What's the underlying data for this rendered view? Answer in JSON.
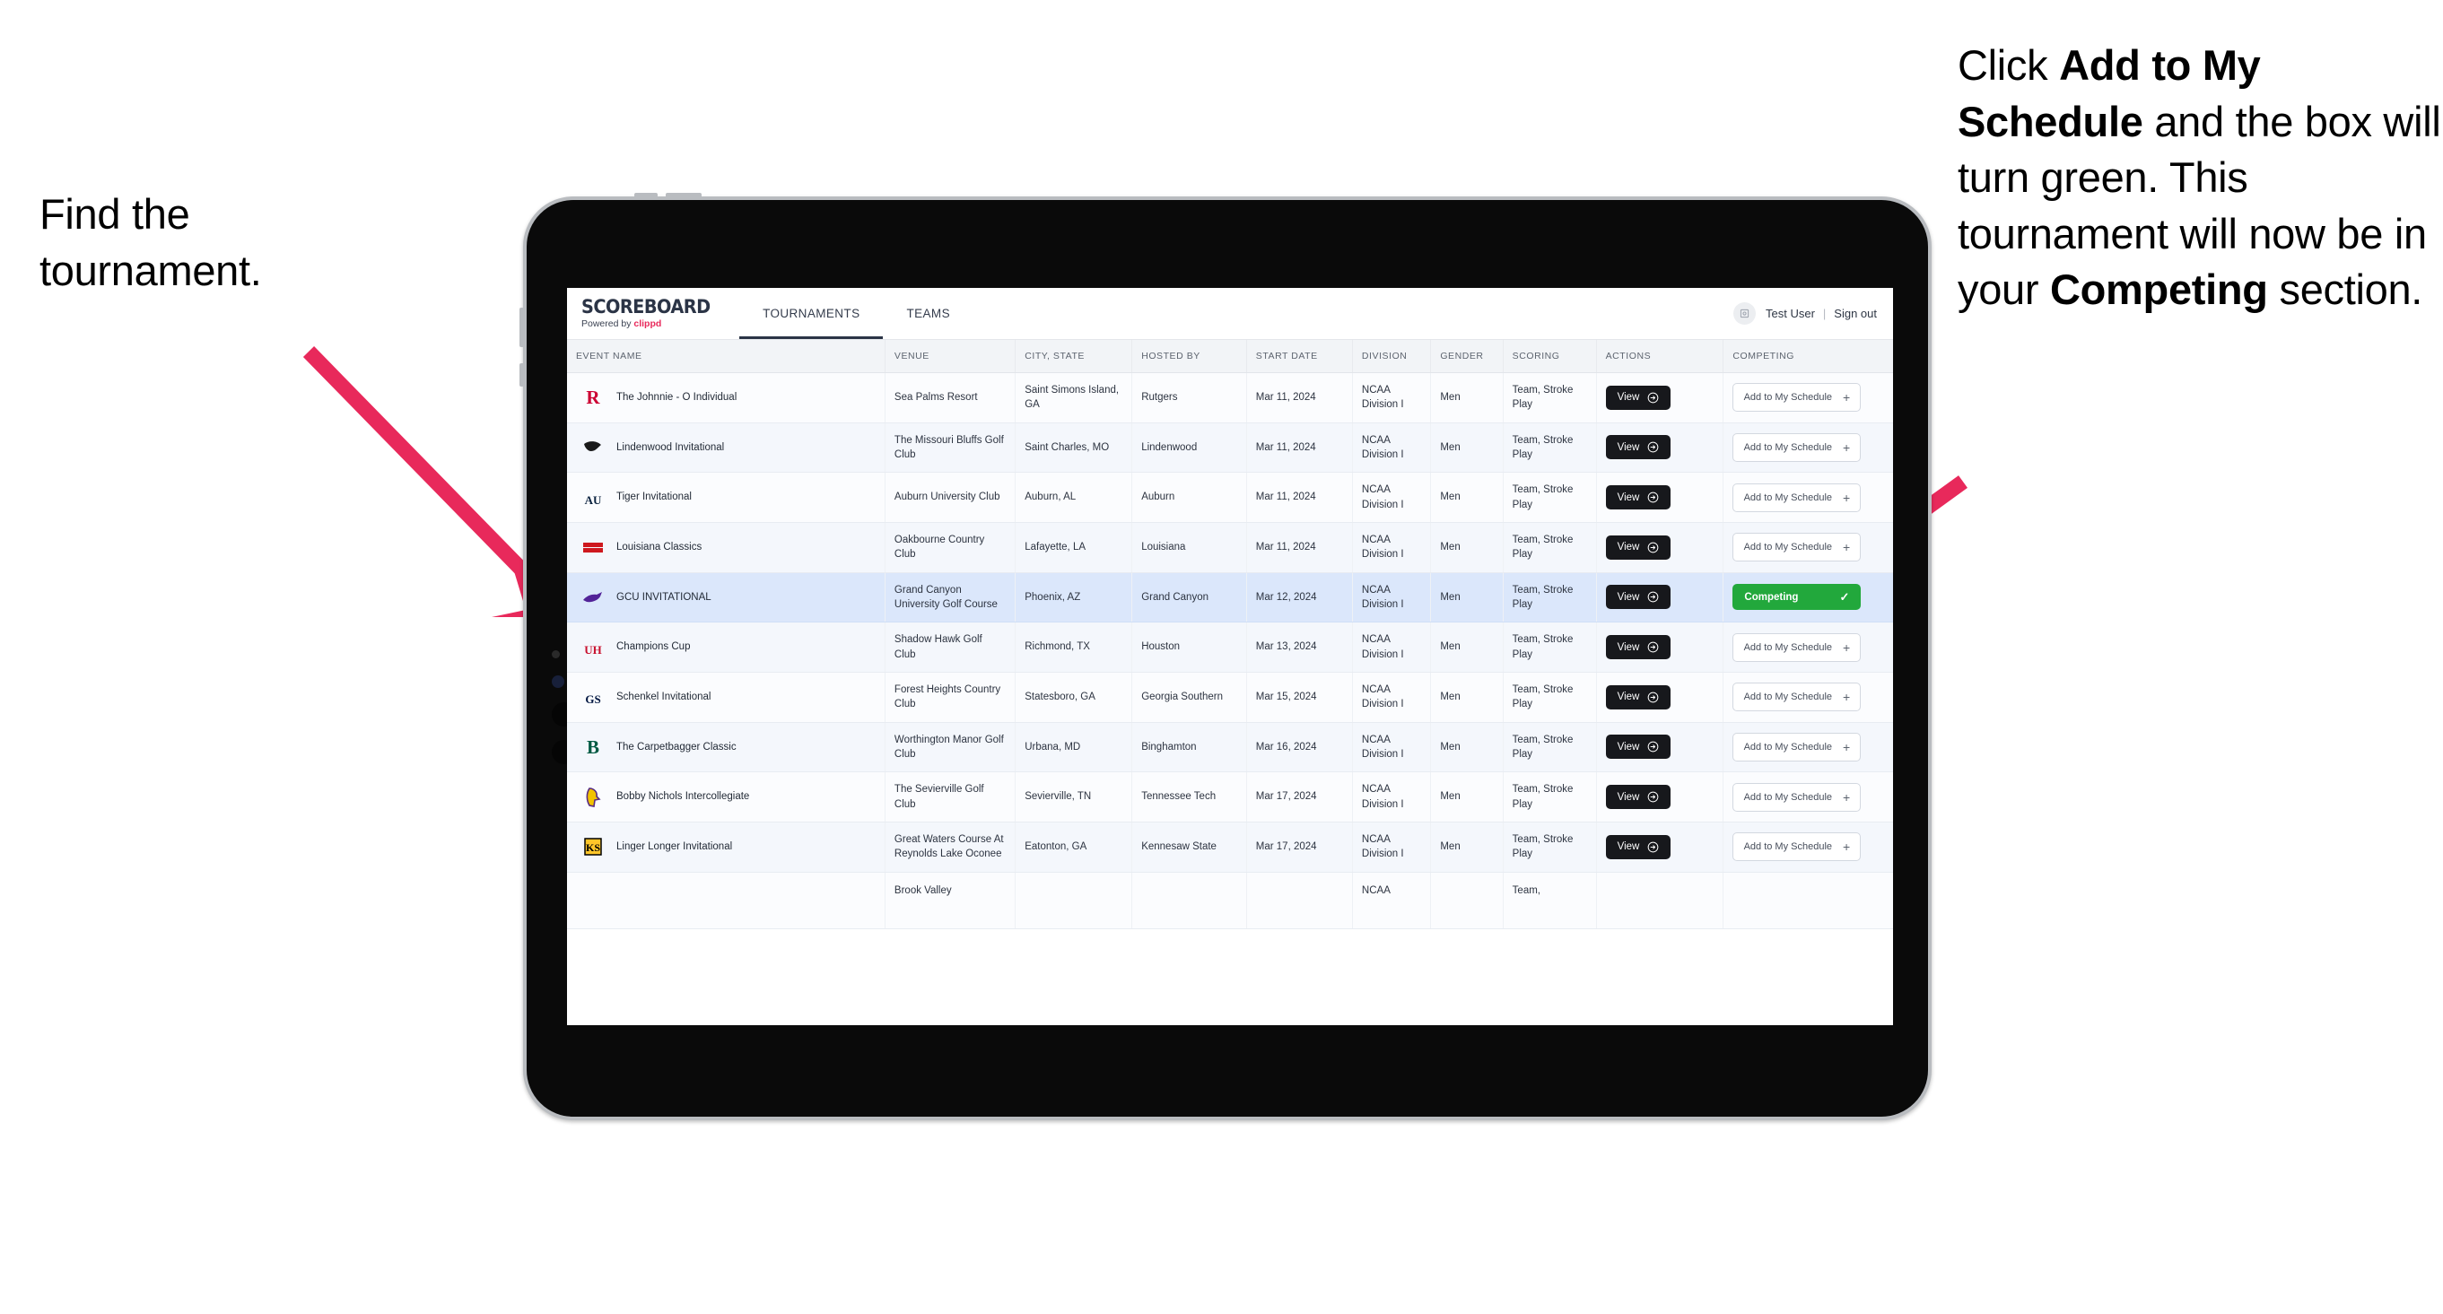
{
  "annotations": {
    "left": "Find the\ntournament.",
    "right_parts": [
      {
        "t": "Click ",
        "b": false
      },
      {
        "t": "Add to My Schedule",
        "b": true
      },
      {
        "t": " and the box will turn green. This tournament will now be in your ",
        "b": false
      },
      {
        "t": "Competing",
        "b": true
      },
      {
        "t": " section.",
        "b": false
      }
    ],
    "arrow_color": "#e8295b"
  },
  "app": {
    "brand": {
      "title": "SCOREBOARD",
      "powered_prefix": "Powered by ",
      "powered_name": "clippd"
    },
    "tabs": [
      {
        "label": "TOURNAMENTS",
        "active": true
      },
      {
        "label": "TEAMS",
        "active": false
      }
    ],
    "user": {
      "name": "Test User",
      "separator": "|",
      "signout": "Sign out",
      "avatar_icon": "user-avatar-icon"
    },
    "table": {
      "columns": [
        "EVENT NAME",
        "VENUE",
        "CITY, STATE",
        "HOSTED BY",
        "START DATE",
        "DIVISION",
        "GENDER",
        "SCORING",
        "ACTIONS",
        "COMPETING"
      ],
      "labels": {
        "view": "View",
        "add": "Add to My Schedule",
        "competing": "Competing"
      },
      "rows": [
        {
          "event": "The Johnnie - O Individual",
          "venue": "Sea Palms Resort",
          "city": "Saint Simons Island, GA",
          "host": "Rutgers",
          "date": "Mar 11, 2024",
          "division": "NCAA Division I",
          "gender": "Men",
          "scoring": "Team, Stroke Play",
          "competing": false,
          "logo": "rutgers-r",
          "logo_color": "#cc0033"
        },
        {
          "event": "Lindenwood Invitational",
          "venue": "The Missouri Bluffs Golf Club",
          "city": "Saint Charles, MO",
          "host": "Lindenwood",
          "date": "Mar 11, 2024",
          "division": "NCAA Division I",
          "gender": "Men",
          "scoring": "Team, Stroke Play",
          "competing": false,
          "logo": "lindenwood-lion",
          "logo_color": "#1a1a1a"
        },
        {
          "event": "Tiger Invitational",
          "venue": "Auburn University Club",
          "city": "Auburn, AL",
          "host": "Auburn",
          "date": "Mar 11, 2024",
          "division": "NCAA Division I",
          "gender": "Men",
          "scoring": "Team, Stroke Play",
          "competing": false,
          "logo": "auburn-au",
          "logo_color": "#0c2340"
        },
        {
          "event": "Louisiana Classics",
          "venue": "Oakbourne Country Club",
          "city": "Lafayette, LA",
          "host": "Louisiana",
          "date": "Mar 11, 2024",
          "division": "NCAA Division I",
          "gender": "Men",
          "scoring": "Team, Stroke Play",
          "competing": false,
          "logo": "ragin-cajuns",
          "logo_color": "#ce181e"
        },
        {
          "event": "GCU INVITATIONAL",
          "venue": "Grand Canyon University Golf Course",
          "city": "Phoenix, AZ",
          "host": "Grand Canyon",
          "date": "Mar 12, 2024",
          "division": "NCAA Division I",
          "gender": "Men",
          "scoring": "Team, Stroke Play",
          "competing": true,
          "selected": true,
          "logo": "gcu-lopes",
          "logo_color": "#522398"
        },
        {
          "event": "Champions Cup",
          "venue": "Shadow Hawk Golf Club",
          "city": "Richmond, TX",
          "host": "Houston",
          "date": "Mar 13, 2024",
          "division": "NCAA Division I",
          "gender": "Men",
          "scoring": "Team, Stroke Play",
          "competing": false,
          "logo": "houston-uh",
          "logo_color": "#c8102e"
        },
        {
          "event": "Schenkel Invitational",
          "venue": "Forest Heights Country Club",
          "city": "Statesboro, GA",
          "host": "Georgia Southern",
          "date": "Mar 15, 2024",
          "division": "NCAA Division I",
          "gender": "Men",
          "scoring": "Team, Stroke Play",
          "competing": false,
          "logo": "georgia-southern-gs",
          "logo_color": "#001641"
        },
        {
          "event": "The Carpetbagger Classic",
          "venue": "Worthington Manor Golf Club",
          "city": "Urbana, MD",
          "host": "Binghamton",
          "date": "Mar 16, 2024",
          "division": "NCAA Division I",
          "gender": "Men",
          "scoring": "Team, Stroke Play",
          "competing": false,
          "logo": "binghamton-b",
          "logo_color": "#005a43"
        },
        {
          "event": "Bobby Nichols Intercollegiate",
          "venue": "The Sevierville Golf Club",
          "city": "Sevierville, TN",
          "host": "Tennessee Tech",
          "date": "Mar 17, 2024",
          "division": "NCAA Division I",
          "gender": "Men",
          "scoring": "Team, Stroke Play",
          "competing": false,
          "logo": "tn-tech-eagle",
          "logo_color": "#582c83"
        },
        {
          "event": "Linger Longer Invitational",
          "venue": "Great Waters Course At Reynolds Lake Oconee",
          "city": "Eatonton, GA",
          "host": "Kennesaw State",
          "date": "Mar 17, 2024",
          "division": "NCAA Division I",
          "gender": "Men",
          "scoring": "Team, Stroke Play",
          "competing": false,
          "logo": "kennesaw-ks",
          "logo_color": "#ffc629"
        }
      ],
      "partial_row": {
        "venue": "Brook Valley",
        "division": "NCAA",
        "scoring": "Team,"
      }
    }
  }
}
